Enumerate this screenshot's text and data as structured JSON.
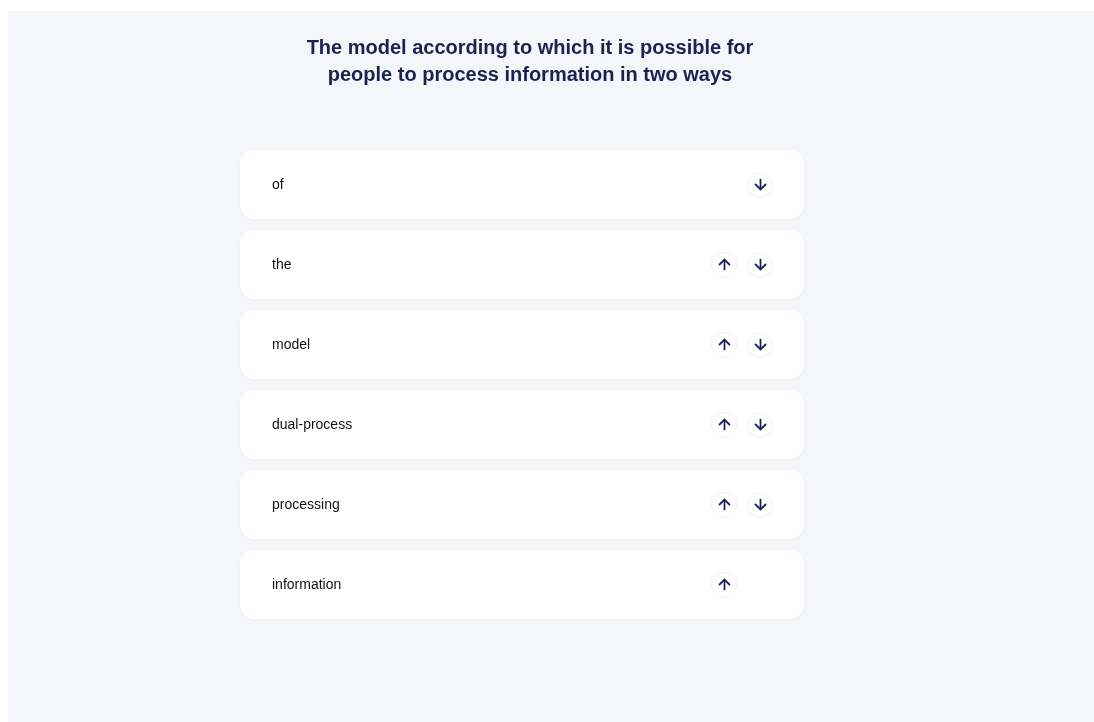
{
  "title": "The model according to which it is possible for people to process information in two ways",
  "items": [
    {
      "label": "of",
      "up_button": false,
      "down_button": true
    },
    {
      "label": "the",
      "up_button": true,
      "down_button": true
    },
    {
      "label": "model",
      "up_button": true,
      "down_button": true
    },
    {
      "label": "dual-process",
      "up_button": true,
      "down_button": true
    },
    {
      "label": "processing",
      "up_button": true,
      "down_button": true
    },
    {
      "label": "information",
      "up_button": true,
      "down_button": false
    }
  ]
}
